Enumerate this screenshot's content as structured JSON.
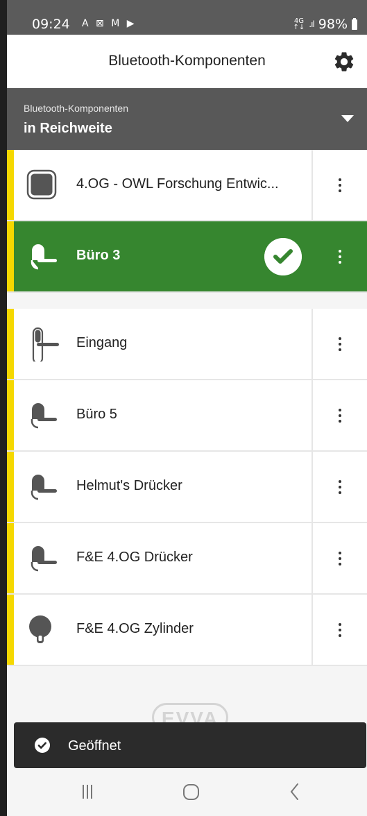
{
  "status_bar": {
    "time": "09:24",
    "notification_icons": "A ⊠ M ▶",
    "network_top": "4G",
    "network_bottom": "↑↓",
    "signal": ".ıl",
    "battery": "98%"
  },
  "app_bar": {
    "title": "Bluetooth-Komponenten",
    "settings_icon": "gear-icon"
  },
  "filter": {
    "label": "Bluetooth-Komponenten",
    "value": "in Reichweite"
  },
  "components": [
    {
      "name": "4.OG - OWL Forschung Entwic...",
      "icon": "square-reader-icon",
      "state": "normal"
    },
    {
      "name": "Büro 3",
      "icon": "door-handle-icon",
      "state": "active",
      "status_icon": "check-circle-icon"
    },
    {
      "name": "Eingang",
      "icon": "long-plate-handle-icon",
      "state": "normal"
    },
    {
      "name": "Büro 5",
      "icon": "door-handle-icon",
      "state": "normal"
    },
    {
      "name": "Helmut's Drücker",
      "icon": "door-handle-icon",
      "state": "normal"
    },
    {
      "name": "F&E 4.OG Drücker",
      "icon": "door-handle-icon",
      "state": "normal"
    },
    {
      "name": "F&E 4.OG Zylinder",
      "icon": "cylinder-icon",
      "state": "normal"
    }
  ],
  "footer": {
    "logo": "EVVA"
  },
  "snackbar": {
    "text": "Geöffnet"
  },
  "navbar": {
    "recents": "|||",
    "home": "○",
    "back": "<"
  },
  "colors": {
    "stripe": "#f5d800",
    "active_row": "#36862f",
    "filter_bar": "#585858",
    "status_bar": "#5b5b5b",
    "snackbar": "#2b2b2b"
  }
}
